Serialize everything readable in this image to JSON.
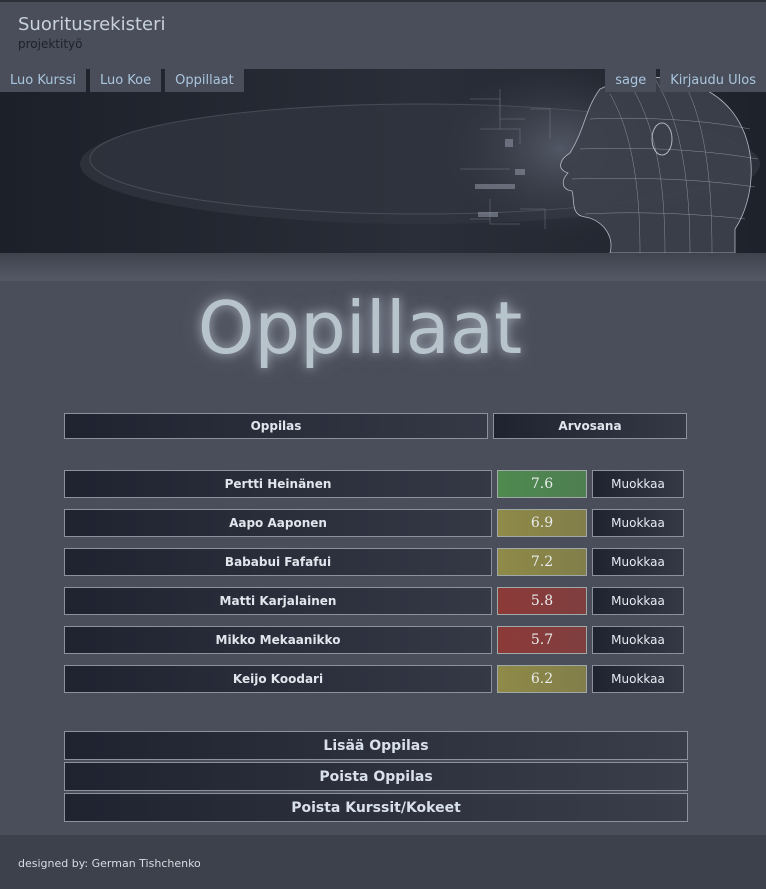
{
  "site": {
    "title": "Suoritusrekisteri",
    "subtitle": "projektityö"
  },
  "nav": {
    "left": [
      {
        "label": "Luo Kurssi"
      },
      {
        "label": "Luo Koe"
      },
      {
        "label": "Oppillaat"
      }
    ],
    "right": [
      {
        "label": "sage"
      },
      {
        "label": "Kirjaudu Ulos"
      }
    ]
  },
  "page": {
    "title": "Oppillaat"
  },
  "table": {
    "headers": {
      "student": "Oppilas",
      "grade": "Arvosana"
    },
    "edit_label": "Muokkaa",
    "rows": [
      {
        "name": "Pertti Heinänen",
        "grade": "7.6",
        "grade_color": "#4f8a4f"
      },
      {
        "name": "Aapo Aaponen",
        "grade": "6.9",
        "grade_color": "#8f8a47"
      },
      {
        "name": "Bababui Fafafui",
        "grade": "7.2",
        "grade_color": "#8f8a47"
      },
      {
        "name": "Matti Karjalainen",
        "grade": "5.8",
        "grade_color": "#8c3a38"
      },
      {
        "name": "Mikko Mekaanikko",
        "grade": "5.7",
        "grade_color": "#8c3a38"
      },
      {
        "name": "Keijo Koodari",
        "grade": "6.2",
        "grade_color": "#8f8a47"
      }
    ]
  },
  "actions": {
    "add_student": "Lisää Oppilas",
    "remove_student": "Poista Oppilas",
    "remove_courses": "Poista Kurssit/Kokeet"
  },
  "footer": {
    "text": "designed by: German Tishchenko"
  }
}
